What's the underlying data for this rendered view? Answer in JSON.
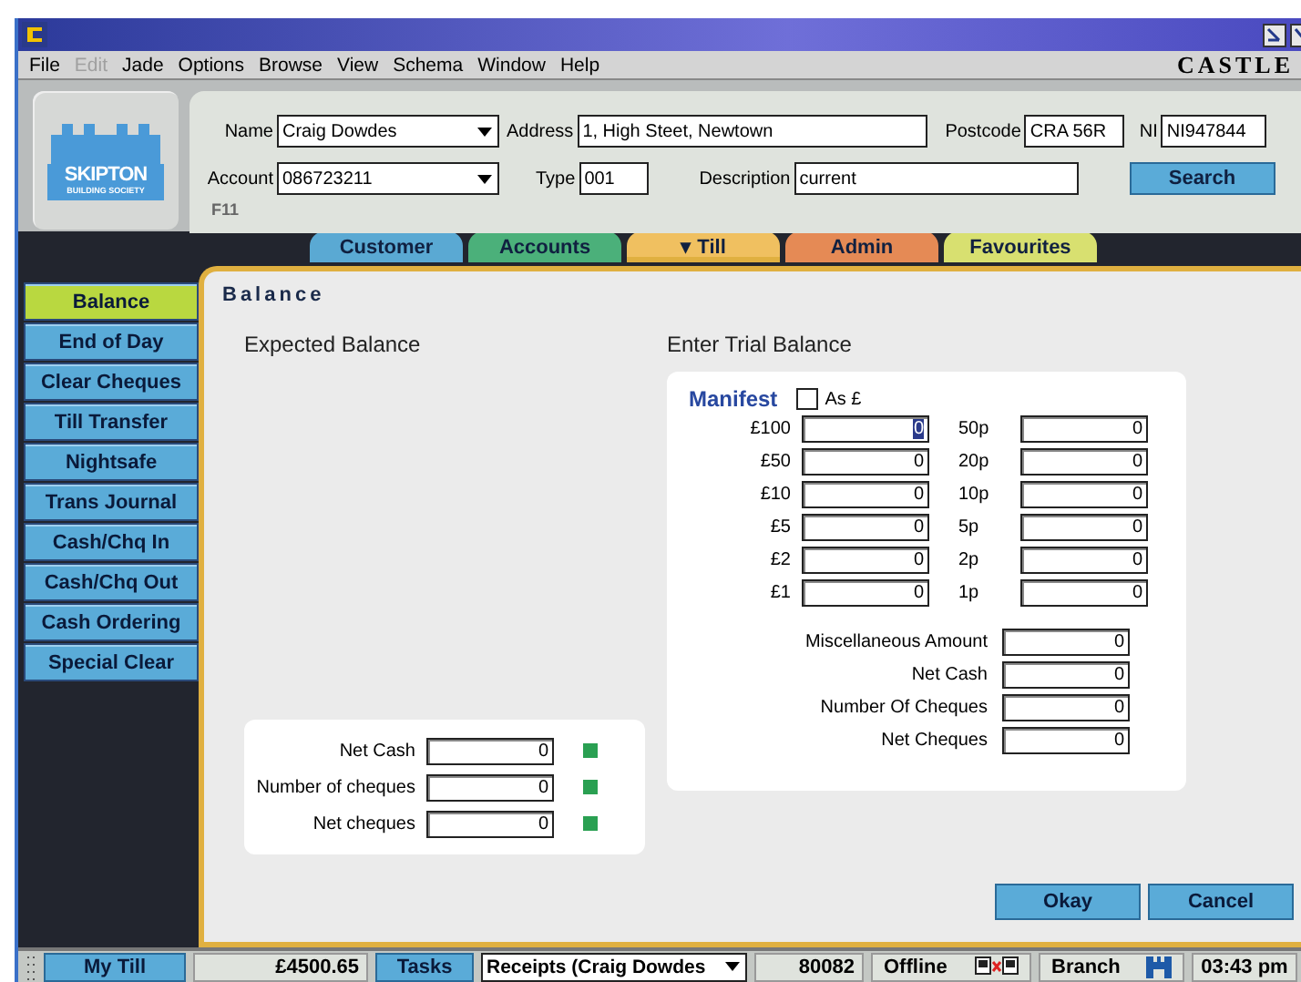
{
  "window": {
    "brand": "CASTLE"
  },
  "menu": [
    {
      "label": "File",
      "disabled": false
    },
    {
      "label": "Edit",
      "disabled": true
    },
    {
      "label": "Jade",
      "disabled": false
    },
    {
      "label": "Options",
      "disabled": false
    },
    {
      "label": "Browse",
      "disabled": false
    },
    {
      "label": "View",
      "disabled": false
    },
    {
      "label": "Schema",
      "disabled": false
    },
    {
      "label": "Window",
      "disabled": false
    },
    {
      "label": "Help",
      "disabled": false
    }
  ],
  "logo": {
    "name": "SKIPTON",
    "subtitle": "BUILDING SOCIETY"
  },
  "search_form": {
    "fields": [
      {
        "kind": "dropdown",
        "label": "Name",
        "value": "Craig Dowdes"
      },
      {
        "kind": "text",
        "label": "Address",
        "value": "1, High Steet, Newtown"
      },
      {
        "kind": "text",
        "label": "Postcode",
        "value": "CRA 56R"
      },
      {
        "kind": "text",
        "label": "NI",
        "value": "NI947844"
      },
      {
        "kind": "dropdown",
        "label": "Account",
        "value": "086723211"
      },
      {
        "kind": "text",
        "label": "Type",
        "value": "001"
      },
      {
        "kind": "text",
        "label": "Description",
        "value": "current"
      }
    ],
    "button": "Search",
    "hotkey": "F11"
  },
  "tabs": [
    {
      "label": "Customer",
      "color": "#5aa9d3",
      "selected": false
    },
    {
      "label": "Accounts",
      "color": "#4bb07a",
      "selected": false
    },
    {
      "label": "▾ Till",
      "color": "#f0c060",
      "selected": true
    },
    {
      "label": "Admin",
      "color": "#e58a55",
      "selected": false
    },
    {
      "label": "Favourites",
      "color": "#d8e070",
      "selected": false
    }
  ],
  "sidebar": {
    "items": [
      {
        "label": "Balance",
        "selected": true
      },
      {
        "label": "End of Day",
        "selected": false
      },
      {
        "label": "Clear Cheques",
        "selected": false
      },
      {
        "label": "Till Transfer",
        "selected": false
      },
      {
        "label": "Nightsafe",
        "selected": false
      },
      {
        "label": "Trans Journal",
        "selected": false
      },
      {
        "label": "Cash/Chq In",
        "selected": false
      },
      {
        "label": "Cash/Chq Out",
        "selected": false
      },
      {
        "label": "Cash Ordering",
        "selected": false
      },
      {
        "label": "Special Clear",
        "selected": false
      }
    ]
  },
  "panel": {
    "title": "Balance",
    "expected": {
      "heading": "Expected Balance",
      "fields": [
        {
          "label": "Net Cash",
          "value": "0"
        },
        {
          "label": "Number of cheques",
          "value": "0"
        },
        {
          "label": "Net cheques",
          "value": "0"
        }
      ]
    },
    "trial": {
      "heading": "Enter Trial Balance",
      "manifest": "Manifest",
      "as_pounds": {
        "label": "As £",
        "checked": false
      },
      "notes": [
        {
          "label": "£100",
          "value": "0",
          "focused": true
        },
        {
          "label": "£50",
          "value": "0",
          "focused": false
        },
        {
          "label": "£10",
          "value": "0",
          "focused": false
        },
        {
          "label": "£5",
          "value": "0",
          "focused": false
        },
        {
          "label": "£2",
          "value": "0",
          "focused": false
        },
        {
          "label": "£1",
          "value": "0",
          "focused": false
        }
      ],
      "coins": [
        {
          "label": "50p",
          "value": "0"
        },
        {
          "label": "20p",
          "value": "0"
        },
        {
          "label": "10p",
          "value": "0"
        },
        {
          "label": "5p",
          "value": "0"
        },
        {
          "label": "2p",
          "value": "0"
        },
        {
          "label": "1p",
          "value": "0"
        }
      ],
      "totals": [
        {
          "label": "Miscellaneous Amount",
          "value": "0"
        },
        {
          "label": "Net Cash",
          "value": "0"
        },
        {
          "label": "Number Of Cheques",
          "value": "0"
        },
        {
          "label": "Net Cheques",
          "value": "0"
        }
      ]
    },
    "buttons": [
      "Okay",
      "Cancel"
    ]
  },
  "status_bar": [
    {
      "kind": "button",
      "text": "My Till"
    },
    {
      "kind": "text",
      "text": "£4500.65"
    },
    {
      "kind": "button",
      "text": "Tasks"
    },
    {
      "kind": "dropdown",
      "text": "Receipts  (Craig Dowdes"
    },
    {
      "kind": "text",
      "text": "80082"
    },
    {
      "kind": "offline",
      "text": "Offline"
    },
    {
      "kind": "branch",
      "text": "Branch"
    },
    {
      "kind": "text",
      "text": "03:43 pm"
    }
  ]
}
